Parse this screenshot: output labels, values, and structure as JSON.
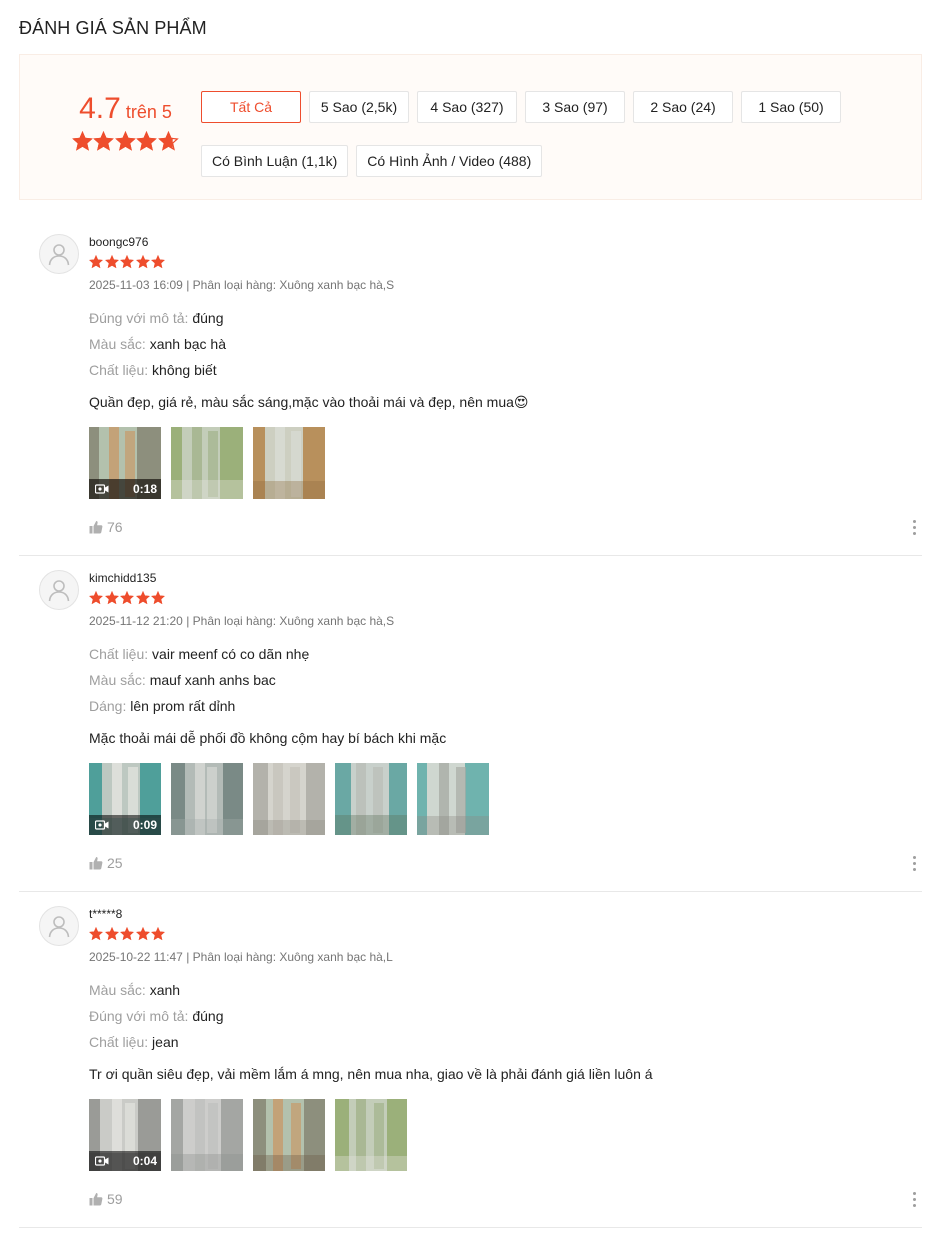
{
  "section_title": "ĐÁNH GIÁ SẢN PHẨM",
  "overview": {
    "score": "4.7",
    "score_suffix": "trên 5",
    "star_rating": 4.7,
    "filters": [
      "Tất Cả",
      "5 Sao (2,5k)",
      "4 Sao (327)",
      "3 Sao (97)",
      "2 Sao (24)",
      "1 Sao (50)",
      "Có Bình Luận (1,1k)",
      "Có Hình Ảnh / Video (488)"
    ],
    "active_filter": "Tất Cả"
  },
  "colors": {
    "accent": "#ee4d2d",
    "muted": "#9e9e9e",
    "meta": "#757575"
  },
  "reviews": [
    {
      "username": "boongc976",
      "stars": 5,
      "meta": "2025-11-03 16:09 | Phân loại hàng: Xuông xanh bạc hà,S",
      "attributes": [
        {
          "label": "Đúng với mô tả:",
          "value": "đúng"
        },
        {
          "label": "Màu sắc:",
          "value": "xanh bạc hà"
        },
        {
          "label": "Chất liệu:",
          "value": "không biết"
        }
      ],
      "comment": "Quần đẹp, giá rẻ, màu sắc sáng,mặc vào thoải mái và đẹp, nên mua😍",
      "video_duration": "0:18",
      "media_count": 3,
      "likes": "76"
    },
    {
      "username": "kimchidd135",
      "stars": 5,
      "meta": "2025-11-12 21:20 | Phân loại hàng: Xuông xanh bạc hà,S",
      "attributes": [
        {
          "label": "Chất liệu:",
          "value": "vair meenf có co dãn nhẹ"
        },
        {
          "label": "Màu sắc:",
          "value": "mauf xanh anhs bac"
        },
        {
          "label": "Dáng:",
          "value": "lên prom rất dỉnh"
        }
      ],
      "comment": "Mặc thoải mái dễ phối đồ không cộm hay bí bách khi mặc",
      "video_duration": "0:09",
      "media_count": 5,
      "likes": "25"
    },
    {
      "username": "t*****8",
      "stars": 5,
      "meta": "2025-10-22 11:47 | Phân loại hàng: Xuông xanh bạc hà,L",
      "attributes": [
        {
          "label": "Màu sắc:",
          "value": "xanh"
        },
        {
          "label": "Đúng với mô tả:",
          "value": "đúng"
        },
        {
          "label": "Chất liệu:",
          "value": "jean"
        }
      ],
      "comment": "Tr ơi quần siêu đẹp, vải mềm lắm á mng, nên mua nha, giao về là phải đánh giá liền luôn á",
      "video_duration": "0:04",
      "media_count": 4,
      "likes": "59"
    }
  ]
}
